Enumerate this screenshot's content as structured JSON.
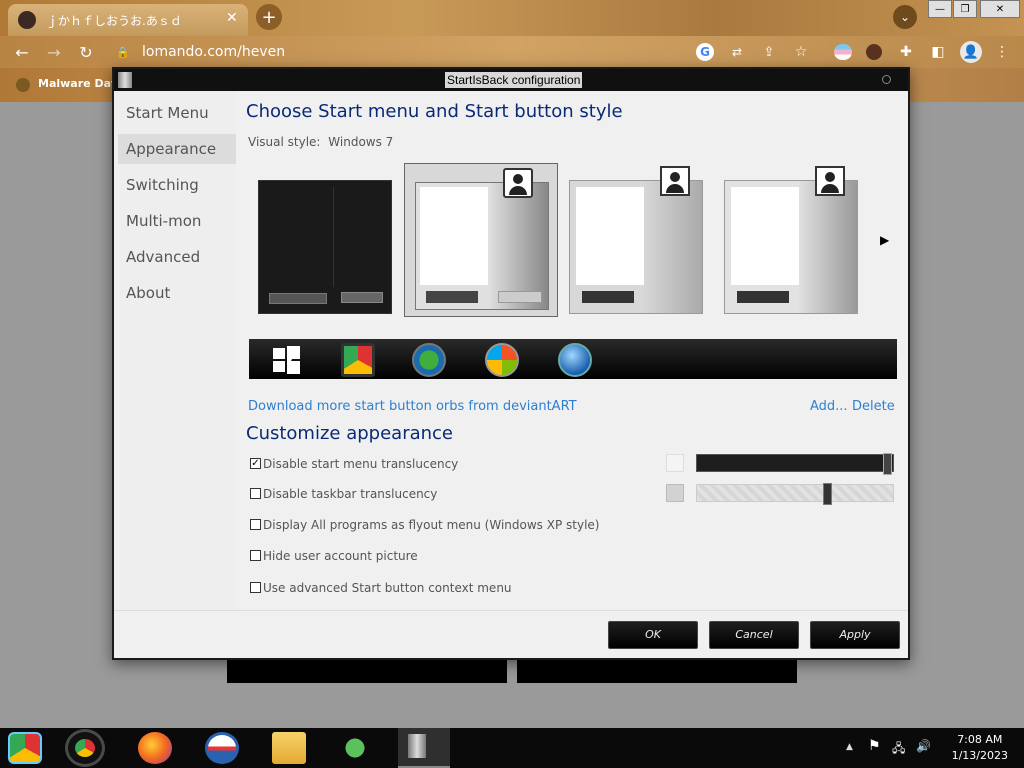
{
  "chrome": {
    "tab_title": "ｊかｈｆしおうお.あｓｄ",
    "new_tab": "+",
    "url": "lomando.com/heven",
    "bookmark": "Malware Datab",
    "window_controls": [
      "—",
      "❐",
      "✕"
    ]
  },
  "dialog": {
    "title": "StartIsBack configuration",
    "nav": [
      "Start Menu",
      "Appearance",
      "Switching",
      "Multi-mon",
      "Advanced",
      "About"
    ],
    "selected_nav": "Appearance",
    "heading1": "Choose Start menu and Start button style",
    "visual_style_label": "Visual style:",
    "visual_style_value": "Windows 7",
    "download_link": "Download more start button orbs from deviantART",
    "add_link": "Add...",
    "delete_link": "Delete",
    "heading2": "Customize appearance",
    "options": [
      {
        "label": "Disable start menu translucency",
        "checked": true
      },
      {
        "label": "Disable taskbar translucency",
        "checked": false
      },
      {
        "label": "Display All programs as flyout menu (Windows XP style)",
        "checked": false
      },
      {
        "label": "Hide user account picture",
        "checked": false
      },
      {
        "label": "Use advanced Start button context menu",
        "checked": false
      }
    ],
    "sliders": [
      {
        "name": "start-menu-opacity",
        "value": 1.0
      },
      {
        "name": "taskbar-opacity",
        "value": 0.65
      }
    ],
    "ok": "OK",
    "cancel": "Cancel",
    "apply": "Apply",
    "next_arrow": "▶"
  },
  "taskbar": {
    "time": "7:08 AM",
    "date": "1/13/2023",
    "tray": [
      "▲",
      "⚑",
      "🖧",
      "🔊"
    ]
  }
}
